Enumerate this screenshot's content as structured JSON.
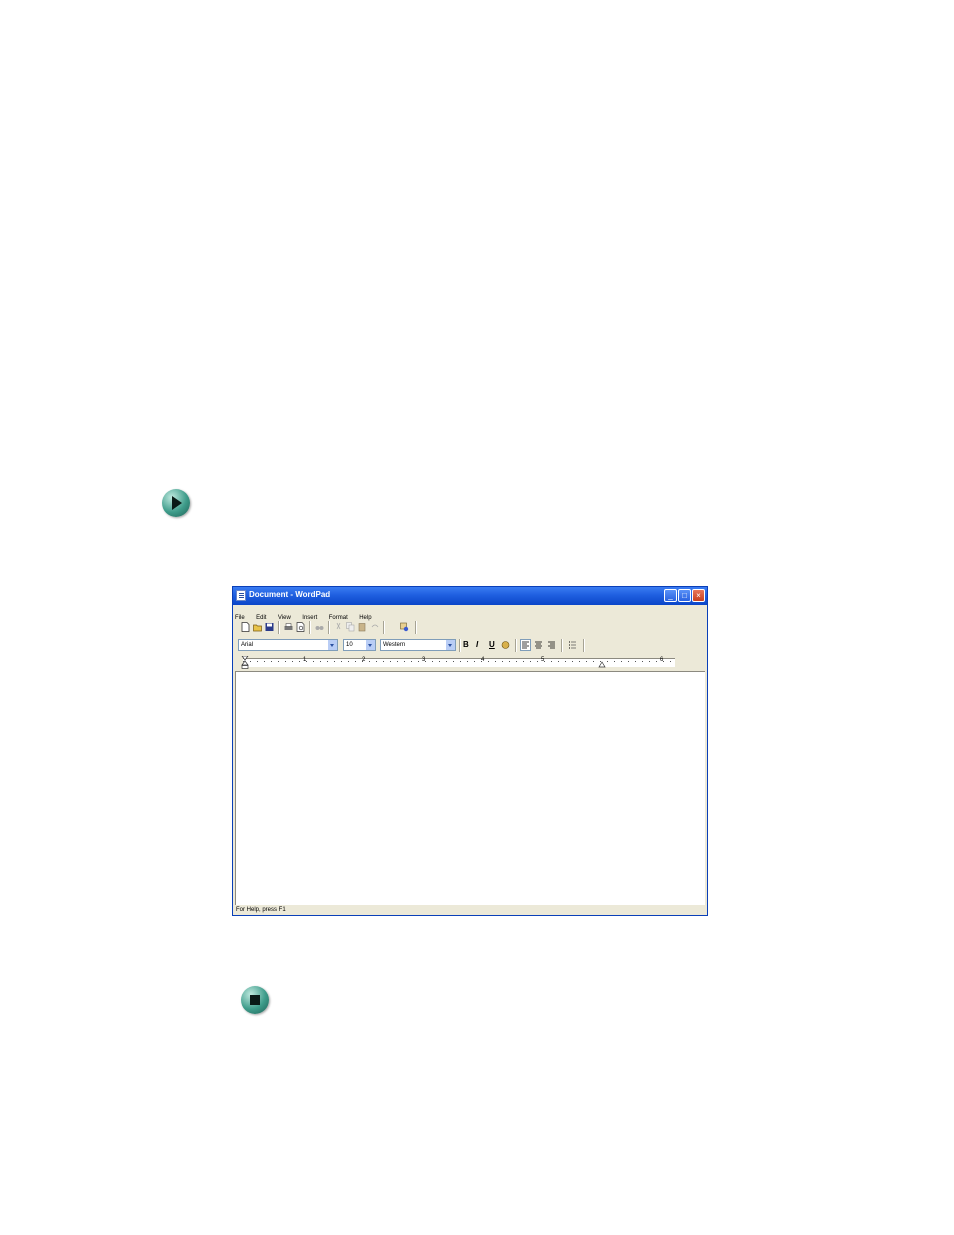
{
  "window": {
    "title": "Document - WordPad",
    "controls": {
      "minimize": "_",
      "maximize": "□",
      "close": "×"
    }
  },
  "menubar": {
    "items": [
      "File",
      "Edit",
      "View",
      "Insert",
      "Format",
      "Help"
    ]
  },
  "format_toolbar": {
    "font_name": "Arial",
    "font_size": "10",
    "script": "Western",
    "bold": "B",
    "italic": "I",
    "underline": "U"
  },
  "ruler": {
    "numbers": [
      "1",
      "2",
      "3",
      "4",
      "5",
      "6"
    ]
  },
  "statusbar": {
    "text": "For Help, press F1"
  },
  "icons": {
    "step": "play-arrow-icon",
    "end": "stop-square-icon"
  },
  "colors": {
    "titlebar": "#1f5fe0",
    "close": "#c8401e",
    "window_bg": "#ece9d8",
    "bullet": "#3e9c8a"
  }
}
